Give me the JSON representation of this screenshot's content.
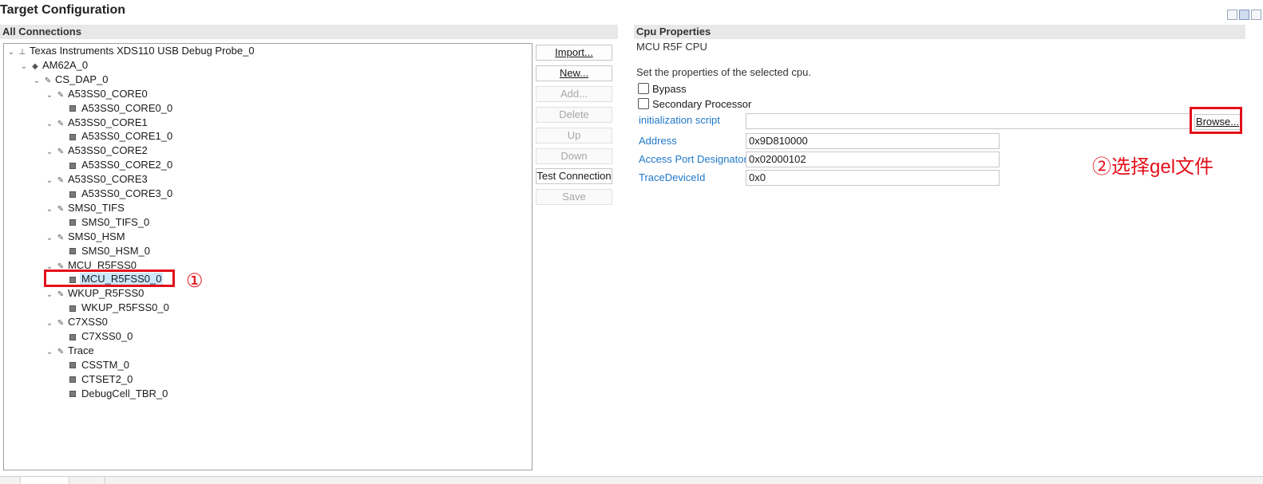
{
  "title": "Target Configuration",
  "all_connections_header": "All Connections",
  "tree": [
    {
      "label": "Texas Instruments XDS110 USB Debug Probe_0",
      "expanded": true,
      "icon": "probe-icon"
    },
    {
      "label": "AM62A_0",
      "expanded": true,
      "icon": "chip-icon"
    },
    {
      "label": "CS_DAP_0",
      "expanded": true,
      "icon": "dap-icon"
    },
    {
      "label": "A53SS0_CORE0",
      "expanded": true,
      "icon": "cpu-group-icon"
    },
    {
      "label": "A53SS0_CORE0_0",
      "icon": "cpu-leaf-icon"
    },
    {
      "label": "A53SS0_CORE1",
      "expanded": true,
      "icon": "cpu-group-icon"
    },
    {
      "label": "A53SS0_CORE1_0",
      "icon": "cpu-leaf-icon"
    },
    {
      "label": "A53SS0_CORE2",
      "expanded": true,
      "icon": "cpu-group-icon"
    },
    {
      "label": "A53SS0_CORE2_0",
      "icon": "cpu-leaf-icon"
    },
    {
      "label": "A53SS0_CORE3",
      "expanded": true,
      "icon": "cpu-group-icon"
    },
    {
      "label": "A53SS0_CORE3_0",
      "icon": "cpu-leaf-icon"
    },
    {
      "label": "SMS0_TIFS",
      "expanded": true,
      "icon": "cpu-group-icon"
    },
    {
      "label": "SMS0_TIFS_0",
      "icon": "cpu-leaf-icon"
    },
    {
      "label": "SMS0_HSM",
      "expanded": true,
      "icon": "cpu-group-icon"
    },
    {
      "label": "SMS0_HSM_0",
      "icon": "cpu-leaf-icon"
    },
    {
      "label": "MCU_R5FSS0",
      "expanded": true,
      "icon": "cpu-group-icon"
    },
    {
      "label": "MCU_R5FSS0_0",
      "icon": "cpu-leaf-icon",
      "selected": true
    },
    {
      "label": "WKUP_R5FSS0",
      "expanded": true,
      "icon": "cpu-group-icon"
    },
    {
      "label": "WKUP_R5FSS0_0",
      "icon": "cpu-leaf-icon"
    },
    {
      "label": "C7XSS0",
      "expanded": true,
      "icon": "cpu-group-icon"
    },
    {
      "label": "C7XSS0_0",
      "icon": "cpu-leaf-icon"
    },
    {
      "label": "Trace",
      "expanded": true,
      "icon": "cpu-group-icon"
    },
    {
      "label": "CSSTM_0",
      "icon": "cpu-leaf-icon"
    },
    {
      "label": "CTSET2_0",
      "icon": "cpu-leaf-icon"
    },
    {
      "label": "DebugCell_TBR_0",
      "icon": "cpu-leaf-icon"
    }
  ],
  "buttons": {
    "import": {
      "label": "Import...",
      "enabled": true
    },
    "new": {
      "label": "New...",
      "enabled": true
    },
    "add": {
      "label": "Add...",
      "enabled": false
    },
    "delete": {
      "label": "Delete",
      "enabled": false
    },
    "up": {
      "label": "Up",
      "enabled": false
    },
    "down": {
      "label": "Down",
      "enabled": false
    },
    "test_connection": {
      "label": "Test Connection",
      "enabled": true
    },
    "save": {
      "label": "Save",
      "enabled": false
    }
  },
  "cpu_properties": {
    "header": "Cpu Properties",
    "cpu_name": "MCU R5F CPU",
    "description": "Set the properties of the selected cpu.",
    "bypass_label": "Bypass",
    "bypass_checked": false,
    "secondary_label": "Secondary Processor",
    "secondary_checked": false,
    "init_script_label": "initialization script",
    "init_script_value": "",
    "browse_label": "Browse...",
    "address_label": "Address",
    "address_value": "0x9D810000",
    "access_port_label": "Access Port Designator",
    "access_port_value": "0x02000102",
    "trace_device_label": "TraceDeviceId",
    "trace_device_value": "0x0"
  },
  "annotations": {
    "step1": "①",
    "step2": "②选择gel文件",
    "color": "#e3101a"
  }
}
